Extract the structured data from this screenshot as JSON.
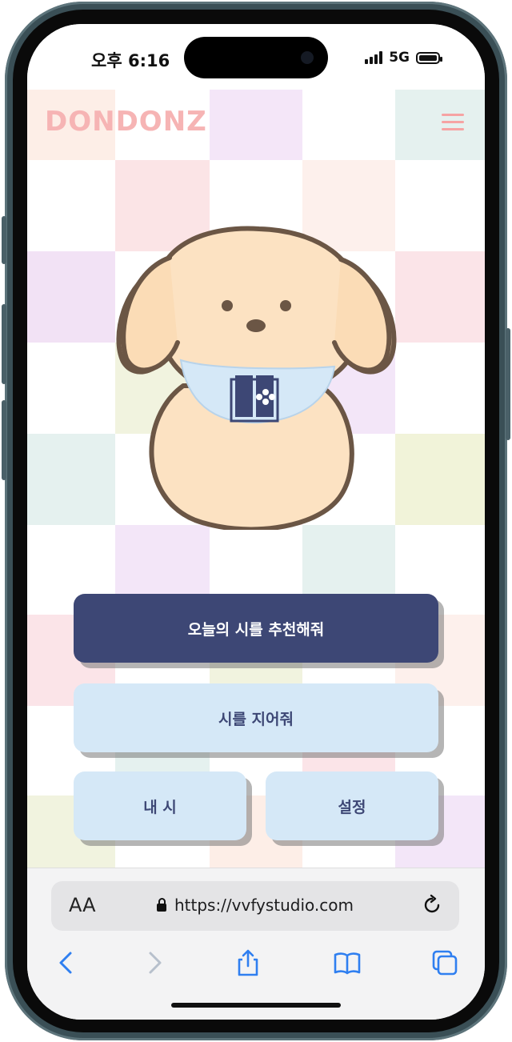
{
  "status_bar": {
    "time": "오후 6:16",
    "network": "5G"
  },
  "site": {
    "logo_text": "DONDONZ",
    "logo_color": "#f6b4b4",
    "menu_icon": "hamburger-icon",
    "mascot": "puppy-reading-book-illustration"
  },
  "buttons": {
    "recommend_label": "오늘의 시를 추천해줘",
    "write_label": "시를 지어줘",
    "my_poems_label": "내 시",
    "settings_label": "설정"
  },
  "colors": {
    "primary": "#3d4775",
    "secondary": "#d5e8f7",
    "accent_pink": "#f6b4b4"
  },
  "browser": {
    "text_size_label": "AA",
    "url": "https://vvfystudio.com",
    "toolbar_icons": [
      "back-icon",
      "forward-icon",
      "share-icon",
      "bookmarks-icon",
      "tabs-icon"
    ]
  }
}
